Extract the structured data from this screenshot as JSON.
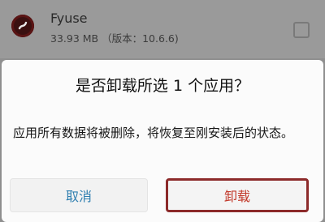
{
  "app_item": {
    "name": "Fyuse",
    "size": "33.93 MB",
    "version": "（版本：10.6.6)",
    "icon": "fyuse-logo-icon",
    "checked": false
  },
  "dialog": {
    "title": "是否卸载所选 1 个应用？",
    "message": "应用所有数据将被删除，将恢复至刚安装后的状态。",
    "cancel_label": "取消",
    "confirm_label": "卸载"
  },
  "colors": {
    "cancel_text": "#2f7fb0",
    "confirm_text": "#c2392a",
    "highlight_border": "#8c2a2a"
  }
}
